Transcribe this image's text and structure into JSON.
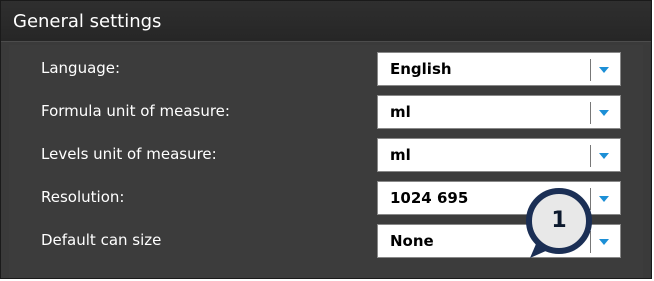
{
  "header": {
    "title": "General settings"
  },
  "settings": [
    {
      "label": "Language:",
      "value": "English"
    },
    {
      "label": "Formula unit of measure:",
      "value": "ml"
    },
    {
      "label": "Levels unit of measure:",
      "value": "ml"
    },
    {
      "label": "Resolution:",
      "value": "1024 695"
    },
    {
      "label": "Default can size",
      "value": "None"
    }
  ],
  "callout": {
    "number": "1"
  },
  "colors": {
    "panel_bg": "#3a3a3a",
    "accent_arrow": "#1c8fd6",
    "callout_fill": "#e8e8e8",
    "callout_ring": "#1b2f55"
  }
}
